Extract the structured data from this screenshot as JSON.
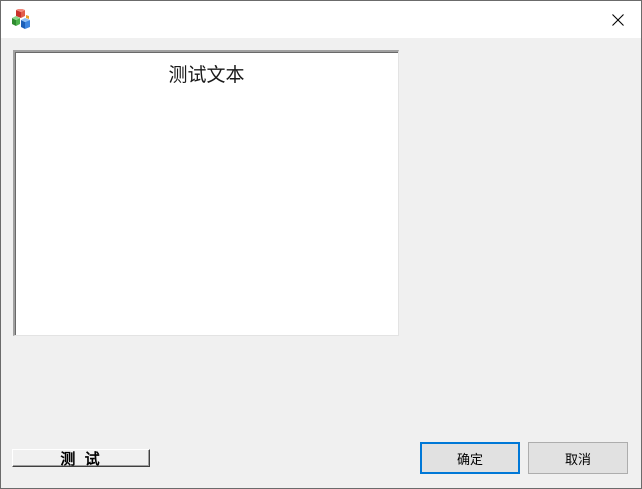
{
  "window": {
    "title": ""
  },
  "textbox": {
    "text": "测试文本"
  },
  "buttons": {
    "test_label": "测 试",
    "ok_label": "确定",
    "cancel_label": "取消"
  },
  "icons": {
    "app": "app-blocks-icon",
    "close": "close-icon"
  },
  "colors": {
    "focus_border": "#0078d7",
    "client_bg": "#f0f0f0"
  }
}
